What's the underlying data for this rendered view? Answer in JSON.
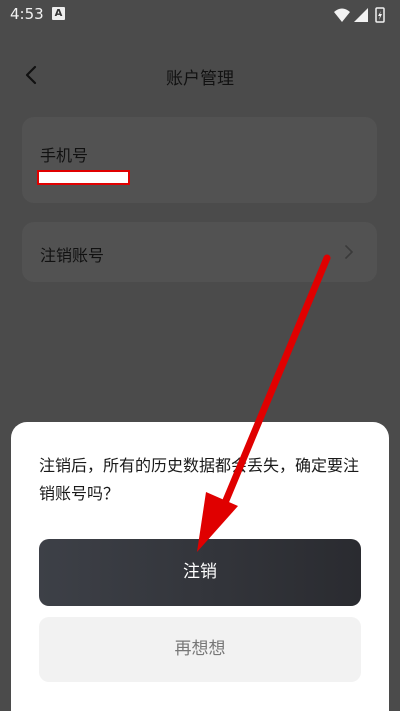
{
  "status_bar": {
    "time": "4:53",
    "notification_badge": "A",
    "icons": [
      "wifi-icon",
      "signal-icon",
      "battery-icon"
    ]
  },
  "header": {
    "title": "账户管理",
    "back_icon": "chevron-left-icon"
  },
  "account": {
    "phone_label": "手机号",
    "cancel_account_label": "注销账号"
  },
  "dialog": {
    "message": "注销后，所有的历史数据都会丢失，确定要注销账号吗？",
    "confirm_label": "注销",
    "cancel_label": "再想想"
  },
  "colors": {
    "overlay": "#4b4b4b",
    "sheet": "#ffffff",
    "confirm_button": "#2f3136",
    "cancel_button": "#f2f2f2",
    "annotation_arrow": "#e00000"
  }
}
